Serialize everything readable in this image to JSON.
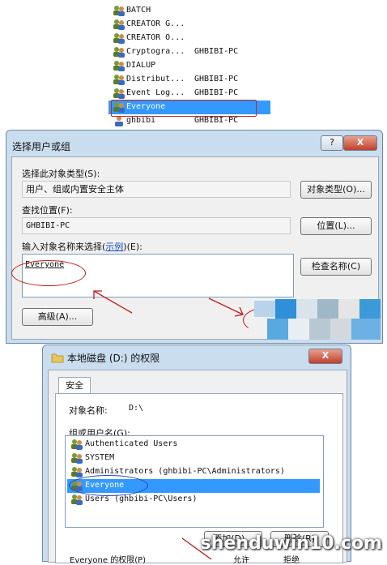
{
  "top_list": {
    "rows": [
      {
        "name": "BATCH",
        "pc": ""
      },
      {
        "name": "CREATOR G...",
        "pc": ""
      },
      {
        "name": "CREATOR O...",
        "pc": ""
      },
      {
        "name": "Cryptogra...",
        "pc": "GHBIBI-PC"
      },
      {
        "name": "DIALUP",
        "pc": ""
      },
      {
        "name": "Distribut...",
        "pc": "GHBIBI-PC"
      },
      {
        "name": "Event Log...",
        "pc": "GHBIBI-PC"
      },
      {
        "name": "Everyone",
        "pc": ""
      },
      {
        "name": "ghbibi",
        "pc": "GHBIBI-PC"
      }
    ]
  },
  "select_dialog": {
    "title": "选择用户或组",
    "help": "?",
    "close": "X",
    "object_type_label": "选择此对象类型(S):",
    "object_type_value": "用户、组或内置安全主体",
    "object_type_button": "对象类型(O)...",
    "location_label": "查找位置(F):",
    "location_value": "GHBIBI-PC",
    "location_button": "位置(L)...",
    "enter_label_pre": "输入对象名称来选择(",
    "enter_label_link": "示例",
    "enter_label_post": ")(E):",
    "entered_name": "Everyone",
    "check_names_button": "检查名称(C)",
    "advanced_button": "高级(A)..."
  },
  "perm_dialog": {
    "title": "本地磁盘 (D:) 的权限",
    "close": "X",
    "tab_security": "安全",
    "object_name_label": "对象名称:",
    "object_name_value": "D:\\",
    "group_label": "组或用户名(G):",
    "users": [
      "Authenticated Users",
      "SYSTEM",
      "Administrators (ghbibi-PC\\Administrators)",
      "Everyone",
      "Users (ghbibi-PC\\Users)"
    ],
    "add_button": "添加(D)...",
    "remove_button": "删除(R)",
    "perm_for_label": "Everyone 的权限(P)",
    "allow_header": "允许",
    "deny_header": "拒绝"
  },
  "watermark": "shenduwin10.com",
  "colors": {
    "selection": "#3399ff",
    "annotation_red": "#c01818",
    "annotation_blue": "#2040c0",
    "dialog_frame": "#c9ddef"
  },
  "icons": {
    "user": "users-group-icon",
    "folder": "folder-icon"
  }
}
